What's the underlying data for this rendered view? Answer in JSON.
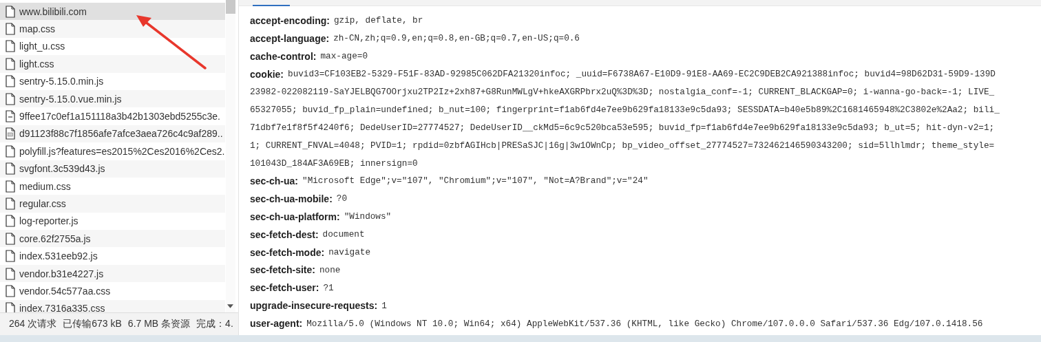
{
  "files": [
    {
      "name": "www.bilibili.com",
      "kind": "doc",
      "selected": true
    },
    {
      "name": "map.css",
      "kind": "doc",
      "selected": false
    },
    {
      "name": "light_u.css",
      "kind": "doc",
      "selected": false
    },
    {
      "name": "light.css",
      "kind": "doc",
      "selected": false
    },
    {
      "name": "sentry-5.15.0.min.js",
      "kind": "doc",
      "selected": false
    },
    {
      "name": "sentry-5.15.0.vue.min.js",
      "kind": "doc",
      "selected": false
    },
    {
      "name": "9ffee17c0ef1a151118a3b42b1303ebd5255c3e.",
      "kind": "dash",
      "selected": false
    },
    {
      "name": "d91123f88c7f1856afe7afce3aea726c4c9af289..",
      "kind": "img",
      "selected": false
    },
    {
      "name": "polyfill.js?features=es2015%2Ces2016%2Ces2.",
      "kind": "doc",
      "selected": false
    },
    {
      "name": "svgfont.3c539d43.js",
      "kind": "doc",
      "selected": false
    },
    {
      "name": "medium.css",
      "kind": "doc",
      "selected": false
    },
    {
      "name": "regular.css",
      "kind": "doc",
      "selected": false
    },
    {
      "name": "log-reporter.js",
      "kind": "doc",
      "selected": false
    },
    {
      "name": "core.62f2755a.js",
      "kind": "doc",
      "selected": false
    },
    {
      "name": "index.531eeb92.js",
      "kind": "doc",
      "selected": false
    },
    {
      "name": "vendor.b31e4227.js",
      "kind": "doc",
      "selected": false
    },
    {
      "name": "vendor.54c577aa.css",
      "kind": "doc",
      "selected": false
    },
    {
      "name": "index.7316a335.css",
      "kind": "doc",
      "selected": false
    }
  ],
  "status_bar": [
    "264 次请求",
    "已传输673 kB",
    "6.7 MB 条资源",
    "完成：4."
  ],
  "headers": [
    {
      "name": "accept-encoding:",
      "lines": [
        "gzip, deflate, br"
      ]
    },
    {
      "name": "accept-language:",
      "lines": [
        "zh-CN,zh;q=0.9,en;q=0.8,en-GB;q=0.7,en-US;q=0.6"
      ]
    },
    {
      "name": "cache-control:",
      "lines": [
        "max-age=0"
      ]
    },
    {
      "name": "cookie:",
      "lines": [
        "buvid3=CF103EB2-5329-F51F-83AD-92985C062DFA21320infoc; _uuid=F6738A67-E10D9-91E8-AA69-EC2C9DEB2CA921388infoc; buvid4=98D62D31-59D9-139D",
        "23982-022082119-SaYJELBQG7OOrjxu2TP2Iz+2xh87+G8RunMWLgV+hkeAXGRPbrx2uQ%3D%3D; nostalgia_conf=-1; CURRENT_BLACKGAP=0; i-wanna-go-back=-1; LIVE_",
        "65327055; buvid_fp_plain=undefined; b_nut=100; fingerprint=f1ab6fd4e7ee9b629fa18133e9c5da93; SESSDATA=b40e5b89%2C1681465948%2C3802e%2Aa2; bili_",
        "71dbf7e1f8f5f4240f6; DedeUserID=27774527; DedeUserID__ckMd5=6c9c520bca53e595; buvid_fp=f1ab6fd4e7ee9b629fa18133e9c5da93; b_ut=5; hit-dyn-v2=1;",
        "1; CURRENT_FNVAL=4048; PVID=1; rpdid=0zbfAGIHcb|PRESaSJC|16g|3w1OWnCp; bp_video_offset_27774527=732462146590343200; sid=5llhlmdr; theme_style=",
        "101043D_184AF3A69EB; innersign=0"
      ]
    },
    {
      "name": "sec-ch-ua:",
      "lines": [
        "\"Microsoft Edge\";v=\"107\", \"Chromium\";v=\"107\", \"Not=A?Brand\";v=\"24\""
      ]
    },
    {
      "name": "sec-ch-ua-mobile:",
      "lines": [
        "?0"
      ]
    },
    {
      "name": "sec-ch-ua-platform:",
      "lines": [
        "\"Windows\""
      ]
    },
    {
      "name": "sec-fetch-dest:",
      "lines": [
        "document"
      ]
    },
    {
      "name": "sec-fetch-mode:",
      "lines": [
        "navigate"
      ]
    },
    {
      "name": "sec-fetch-site:",
      "lines": [
        "none"
      ]
    },
    {
      "name": "sec-fetch-user:",
      "lines": [
        "?1"
      ]
    },
    {
      "name": "upgrade-insecure-requests:",
      "lines": [
        "1"
      ]
    },
    {
      "name": "user-agent:",
      "lines": [
        "Mozilla/5.0 (Windows NT 10.0; Win64; x64) AppleWebKit/537.36 (KHTML, like Gecko) Chrome/107.0.0.0 Safari/537.36 Edg/107.0.1418.56"
      ]
    }
  ]
}
